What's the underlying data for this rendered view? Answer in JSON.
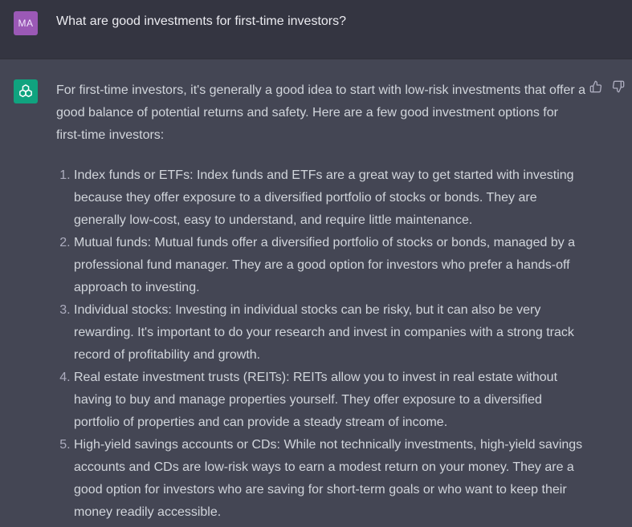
{
  "user": {
    "initials": "MA",
    "message": "What are good investments for first-time investors?"
  },
  "assistant": {
    "intro": "For first-time investors, it's generally a good idea to start with low-risk investments that offer a good balance of potential returns and safety. Here are a few good investment options for first-time investors:",
    "items": [
      "Index funds or ETFs: Index funds and ETFs are a great way to get started with investing because they offer exposure to a diversified portfolio of stocks or bonds. They are generally low-cost, easy to understand, and require little maintenance.",
      "Mutual funds: Mutual funds offer a diversified portfolio of stocks or bonds, managed by a professional fund manager. They are a good option for investors who prefer a hands-off approach to investing.",
      "Individual stocks: Investing in individual stocks can be risky, but it can also be very rewarding. It's important to do your research and invest in companies with a strong track record of profitability and growth.",
      "Real estate investment trusts (REITs): REITs allow you to invest in real estate without having to buy and manage properties yourself. They offer exposure to a diversified portfolio of properties and can provide a steady stream of income.",
      "High-yield savings accounts or CDs: While not technically investments, high-yield savings accounts and CDs are low-risk ways to earn a modest return on your money. They are a good option for investors who are saving for short-term goals or who want to keep their money readily accessible."
    ]
  },
  "icons": {
    "assistant_avatar": "openai-logo-icon",
    "like": "thumbs-up-icon",
    "dislike": "thumbs-down-icon"
  },
  "colors": {
    "user_bg": "#343541",
    "assistant_bg": "#444654",
    "user_avatar": "#9b59b6",
    "assistant_avatar": "#10a37f"
  }
}
